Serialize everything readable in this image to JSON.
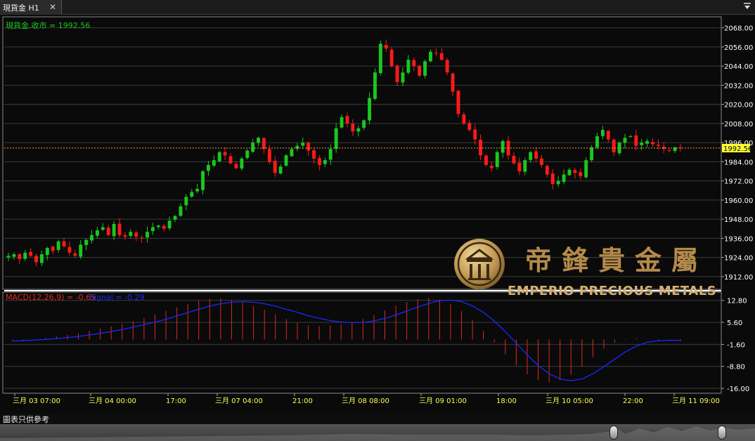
{
  "tab": {
    "title": "現貨金 H1",
    "close_glyph": "✕"
  },
  "price_panel": {
    "label": "現貨金.收市 = 1992.56"
  },
  "macd_panel": {
    "label_macd": "MACD(12,26,9) = -0.65",
    "label_signal": "Signal = -0.29"
  },
  "footer": {
    "note": "圖表只供參考"
  },
  "logo": {
    "chinese": "帝鋒貴金屬",
    "english": "EMPERIO PRECIOUS METALS"
  },
  "colors": {
    "up": "#19c81e",
    "down": "#ff1a1a",
    "signal": "#1a28ff",
    "macd_hist": "#e0281e",
    "current_line": "#ff9933",
    "current_tag": "#ffff33",
    "grid": "#3c3c3c",
    "axis_text": "#ffffff",
    "time_text": "#ffff55",
    "label_green": "#19c81e"
  },
  "chart_data": [
    {
      "type": "candlestick",
      "title": "現貨金 H1",
      "ylim": [
        1904,
        2074
      ],
      "yticks": [
        "2068.00",
        "2056.00",
        "2044.00",
        "2032.00",
        "2020.00",
        "2008.00",
        "1996.00",
        "1984.00",
        "1972.00",
        "1960.00",
        "1948.00",
        "1936.00",
        "1924.00",
        "1912.00"
      ],
      "current_price": "1992.56",
      "xticks": [
        "三月 03 07:00",
        "三月 04 00:00",
        "17:00",
        "三月 07 04:00",
        "21:00",
        "三月 08 08:00",
        "三月 09 01:00",
        "18:00",
        "三月 10 05:00",
        "22:00",
        "三月 11 09:00"
      ],
      "close_path": [
        1925,
        1926,
        1923,
        1927,
        1925,
        1921,
        1926,
        1930,
        1928,
        1934,
        1931,
        1927,
        1925,
        1932,
        1935,
        1938,
        1941,
        1943,
        1938,
        1945,
        1938,
        1937,
        1940,
        1937,
        1936,
        1940,
        1943,
        1944,
        1942,
        1947,
        1950,
        1956,
        1962,
        1965,
        1967,
        1978,
        1982,
        1985,
        1990,
        1988,
        1983,
        1980,
        1986,
        1991,
        1996,
        1999,
        1992,
        1984,
        1977,
        1981,
        1988,
        1992,
        1994,
        1996,
        1991,
        1986,
        1982,
        1985,
        1992,
        2005,
        2012,
        2008,
        2003,
        2005,
        2010,
        2024,
        2040,
        2058,
        2055,
        2044,
        2034,
        2040,
        2048,
        2044,
        2038,
        2047,
        2053,
        2052,
        2048,
        2040,
        2028,
        2014,
        2008,
        2004,
        1998,
        1988,
        1982,
        1980,
        1990,
        1997,
        1988,
        1983,
        1978,
        1985,
        1990,
        1986,
        1982,
        1976,
        1970,
        1972,
        1976,
        1979,
        1977,
        1975,
        1985,
        1993,
        2000,
        2004,
        1998,
        1990,
        1996,
        1999,
        2000,
        1994,
        1996,
        1997,
        1995,
        1994,
        1992,
        1991,
        1993,
        1992.56
      ],
      "macd": [
        -0.5,
        -0.3,
        0.1,
        0.5,
        1.0,
        1.5,
        2.1,
        2.8,
        3.5,
        4.3,
        5.1,
        6.0,
        7.0,
        8.1,
        9.3,
        10.5,
        11.6,
        12.7,
        13.4,
        13.5,
        13.0,
        12.1,
        11.0,
        9.7,
        8.2,
        6.7,
        5.4,
        4.6,
        4.4,
        4.6,
        5.0,
        5.7,
        6.7,
        8.0,
        9.5,
        11.0,
        12.3,
        13.2,
        13.6,
        13.0,
        11.6,
        9.3,
        6.3,
        2.8,
        -1.0,
        -4.9,
        -8.5,
        -11.4,
        -13.3,
        -14.0,
        -13.4,
        -11.6,
        -8.9,
        -5.8,
        -3.0,
        -1.0,
        0.2,
        0.4,
        0.1,
        -0.3,
        -0.5,
        -0.65
      ],
      "signal": [
        -0.5,
        -0.4,
        -0.2,
        0.0,
        0.3,
        0.6,
        1.0,
        1.5,
        2.0,
        2.6,
        3.3,
        4.0,
        4.8,
        5.7,
        6.6,
        7.7,
        8.8,
        9.9,
        10.9,
        11.7,
        12.2,
        12.4,
        12.2,
        11.7,
        10.9,
        9.9,
        8.9,
        7.8,
        6.9,
        6.2,
        5.7,
        5.5,
        5.6,
        6.1,
        6.9,
        8.0,
        9.3,
        10.6,
        11.8,
        12.7,
        12.9,
        12.4,
        11.0,
        8.9,
        6.0,
        2.6,
        -1.2,
        -5.0,
        -8.5,
        -11.2,
        -12.9,
        -13.5,
        -12.9,
        -11.2,
        -8.9,
        -6.4,
        -4.0,
        -2.1,
        -0.9,
        -0.4,
        -0.3,
        -0.29
      ],
      "macd_ylim": [
        -17.6,
        15.5
      ],
      "macd_yticks": [
        "12.80",
        "5.60",
        "-1.60",
        "-8.80",
        "-16.00"
      ]
    }
  ]
}
